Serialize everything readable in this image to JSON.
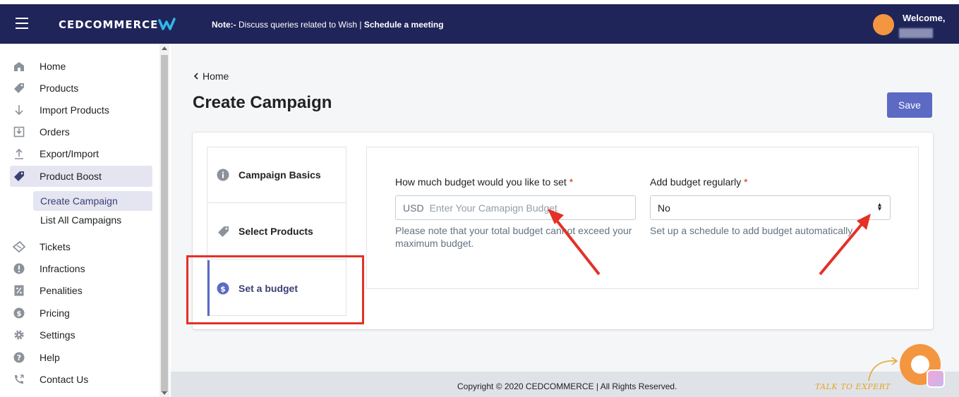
{
  "topbar": {
    "brand": "CEDCOMMERCE",
    "note_prefix": "Note:-",
    "note_text": " Discuss queries related to Wish | ",
    "note_link": "Schedule a meeting",
    "welcome": "Welcome,"
  },
  "sidebar": {
    "items": [
      {
        "label": "Home",
        "icon": "home-icon"
      },
      {
        "label": "Products",
        "icon": "tag-icon"
      },
      {
        "label": "Import Products",
        "icon": "arrow-down-icon"
      },
      {
        "label": "Orders",
        "icon": "inbox-download-icon"
      },
      {
        "label": "Export/Import",
        "icon": "upload-icon"
      },
      {
        "label": "Product Boost",
        "icon": "tag-icon"
      },
      {
        "label": "Tickets",
        "icon": "ticket-icon"
      },
      {
        "label": "Infractions",
        "icon": "alert-icon"
      },
      {
        "label": "Penalities",
        "icon": "percent-icon"
      },
      {
        "label": "Pricing",
        "icon": "dollar-icon"
      },
      {
        "label": "Settings",
        "icon": "gear-icon"
      },
      {
        "label": "Help",
        "icon": "question-icon"
      },
      {
        "label": "Contact Us",
        "icon": "phone-icon"
      }
    ],
    "sub_items": [
      {
        "label": "Create Campaign"
      },
      {
        "label": "List All Campaigns"
      }
    ]
  },
  "main": {
    "breadcrumb": "Home",
    "title": "Create Campaign",
    "save_label": "Save",
    "steps": [
      {
        "label": "Campaign Basics",
        "icon": "info-icon"
      },
      {
        "label": "Select Products",
        "icon": "tag-icon"
      },
      {
        "label": "Set a budget",
        "icon": "dollar-icon"
      }
    ],
    "budget": {
      "label": "How much budget would you like to set",
      "required_mark": "*",
      "prefix": "USD",
      "placeholder": "Enter Your Camapign Budget",
      "help_line1": "Please note that your total budget cannot exceed your",
      "help_line2": "maximum budget."
    },
    "regular": {
      "label": "Add budget regularly",
      "required_mark": "*",
      "value": "No",
      "help": "Set up a schedule to add budget automatically."
    }
  },
  "footer": {
    "copyright": "Copyright © 2020 CEDCOMMERCE | All Rights Reserved.",
    "talk_to_expert": "TALK TO EXPERT"
  },
  "colors": {
    "topbar": "#1f2559",
    "primary": "#5c6ac4",
    "annotation": "#e53026",
    "chat": "#f4953f"
  }
}
